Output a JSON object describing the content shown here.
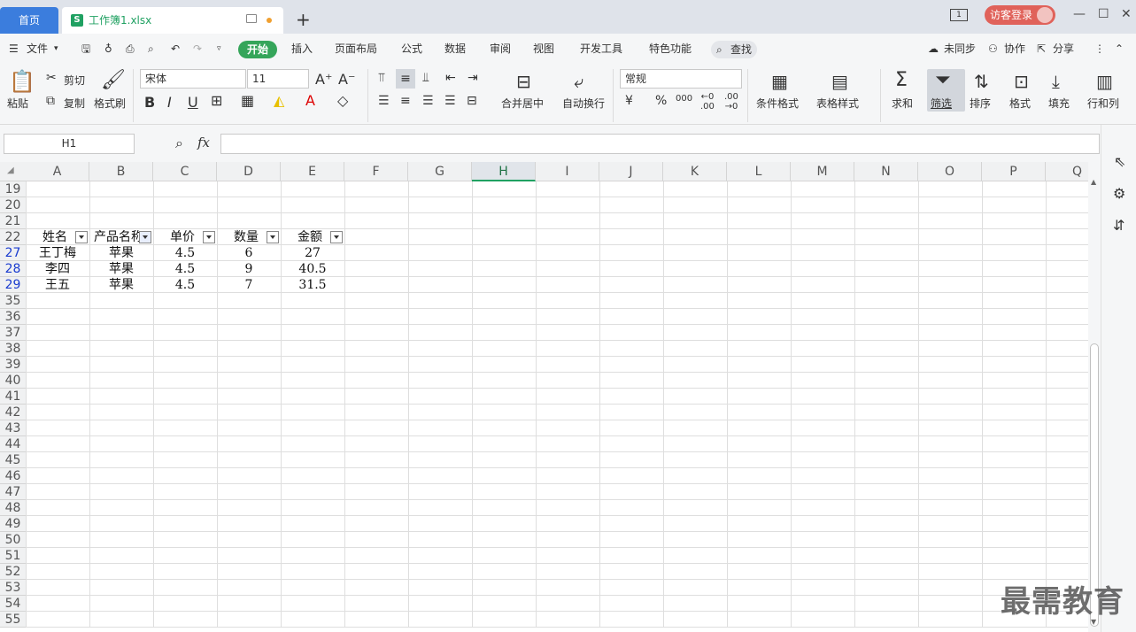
{
  "titlebar": {
    "home_tab": "首页",
    "doc_tab": "工作簿1.xlsx",
    "doc_icon": "S",
    "new_tab": "+",
    "window_badge": "1",
    "login": "访客登录",
    "minimize": "—",
    "maximize": "☐",
    "close": "✕"
  },
  "menubar": {
    "file": "文件",
    "items": [
      "开始",
      "插入",
      "页面布局",
      "公式",
      "数据",
      "审阅",
      "视图",
      "开发工具",
      "特色功能"
    ],
    "search": "查找",
    "sync": "未同步",
    "collab": "协作",
    "share": "分享"
  },
  "ribbon": {
    "paste": "粘贴",
    "cut": "剪切",
    "copy": "复制",
    "format_painter": "格式刷",
    "font_name": "宋体",
    "font_size": "11",
    "merge_center": "合并居中",
    "wrap_text": "自动换行",
    "number_format": "常规",
    "conditional_format": "条件格式",
    "table_style": "表格样式",
    "sum": "求和",
    "filter": "筛选",
    "sort": "排序",
    "format": "格式",
    "fill": "填充",
    "row_col": "行和列"
  },
  "formula_bar": {
    "name_box": "H1",
    "fx": "fx",
    "value": ""
  },
  "sheet": {
    "columns": [
      "A",
      "B",
      "C",
      "D",
      "E",
      "F",
      "G",
      "H",
      "I",
      "J",
      "K",
      "L",
      "M",
      "N",
      "O",
      "P",
      "Q"
    ],
    "selected_column": "H",
    "rows": [
      "19",
      "20",
      "21",
      "22",
      "27",
      "28",
      "29",
      "35",
      "36",
      "37",
      "38",
      "39",
      "40",
      "41",
      "42",
      "43",
      "44",
      "45",
      "46",
      "47",
      "48",
      "49",
      "50",
      "51",
      "52",
      "53",
      "54",
      "55"
    ],
    "filtered_rows": [
      "27",
      "28",
      "29"
    ],
    "header": [
      "姓名",
      "产品名称",
      "单价",
      "数量",
      "金额"
    ],
    "header_display_b": "产品名称",
    "data": [
      [
        "王丁梅",
        "苹果",
        "4.5",
        "6",
        "27"
      ],
      [
        "李四",
        "苹果",
        "4.5",
        "9",
        "40.5"
      ],
      [
        "王五",
        "苹果",
        "4.5",
        "7",
        "31.5"
      ]
    ]
  },
  "watermark": "最需教育"
}
